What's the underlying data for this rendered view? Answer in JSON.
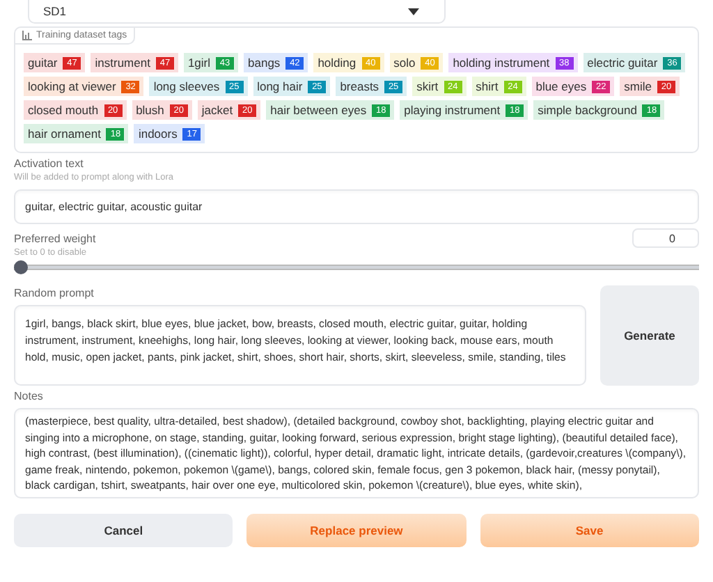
{
  "model_select": {
    "value": "SD1"
  },
  "tags_panel": {
    "title": "Training dataset tags",
    "tags": [
      {
        "label": "guitar",
        "count": "47",
        "color": "#dc2626"
      },
      {
        "label": "instrument",
        "count": "47",
        "color": "#dc2626"
      },
      {
        "label": "1girl",
        "count": "43",
        "color": "#16a34a"
      },
      {
        "label": "bangs",
        "count": "42",
        "color": "#2563eb"
      },
      {
        "label": "holding",
        "count": "40",
        "color": "#eab308"
      },
      {
        "label": "solo",
        "count": "40",
        "color": "#eab308"
      },
      {
        "label": "holding instrument",
        "count": "38",
        "color": "#9333ea"
      },
      {
        "label": "electric guitar",
        "count": "36",
        "color": "#0d9488"
      },
      {
        "label": "looking at viewer",
        "count": "32",
        "color": "#ea580c"
      },
      {
        "label": "long sleeves",
        "count": "25",
        "color": "#0891b2"
      },
      {
        "label": "long hair",
        "count": "25",
        "color": "#0891b2"
      },
      {
        "label": "breasts",
        "count": "25",
        "color": "#0891b2"
      },
      {
        "label": "skirt",
        "count": "24",
        "color": "#84cc16"
      },
      {
        "label": "shirt",
        "count": "24",
        "color": "#84cc16"
      },
      {
        "label": "blue eyes",
        "count": "22",
        "color": "#db2777"
      },
      {
        "label": "smile",
        "count": "20",
        "color": "#dc2626"
      },
      {
        "label": "closed mouth",
        "count": "20",
        "color": "#dc2626"
      },
      {
        "label": "blush",
        "count": "20",
        "color": "#dc2626"
      },
      {
        "label": "jacket",
        "count": "20",
        "color": "#dc2626"
      },
      {
        "label": "hair between eyes",
        "count": "18",
        "color": "#16a34a"
      },
      {
        "label": "playing instrument",
        "count": "18",
        "color": "#16a34a"
      },
      {
        "label": "simple background",
        "count": "18",
        "color": "#16a34a"
      },
      {
        "label": "hair ornament",
        "count": "18",
        "color": "#16a34a"
      },
      {
        "label": "indoors",
        "count": "17",
        "color": "#2563eb"
      }
    ]
  },
  "activation_text": {
    "label": "Activation text",
    "hint": "Will be added to prompt along with Lora",
    "value": "guitar, electric guitar, acoustic guitar"
  },
  "preferred_weight": {
    "label": "Preferred weight",
    "hint": "Set to 0 to disable",
    "value": "0",
    "level": 0
  },
  "random_prompt": {
    "label": "Random prompt",
    "value": "1girl, bangs, black skirt, blue eyes, blue jacket, bow, breasts, closed mouth, electric guitar, guitar, holding instrument, instrument, kneehighs, long hair, long sleeves, looking at viewer, looking back, mouse ears, mouth hold, music, open jacket, pants, pink jacket, shirt, shoes, short hair, shorts, skirt, sleeveless, smile, standing, tiles",
    "button": "Generate"
  },
  "notes": {
    "label": "Notes",
    "value": "(masterpiece, best quality, ultra-detailed, best shadow), (detailed background, cowboy shot, backlighting, playing electric guitar and singing into a microphone, on stage, standing, guitar, looking forward, serious expression, bright stage lighting),  (beautiful detailed face), high contrast, (best illumination), ((cinematic light)), colorful, hyper detail, dramatic light, intricate details, (gardevoir,creatures \\(company\\), game freak, nintendo, pokemon, pokemon \\(game\\), bangs, colored skin, female focus, gen 3 pokemon, black hair, (messy ponytail), black cardigan, tshirt, sweatpants, hair over one eye, multicolored skin, pokemon \\(creature\\), blue eyes, white skin),"
  },
  "buttons": [
    {
      "label": "Cancel",
      "kind": "secondary"
    },
    {
      "label": "Replace preview",
      "kind": "primary"
    },
    {
      "label": "Save",
      "kind": "primary"
    }
  ]
}
